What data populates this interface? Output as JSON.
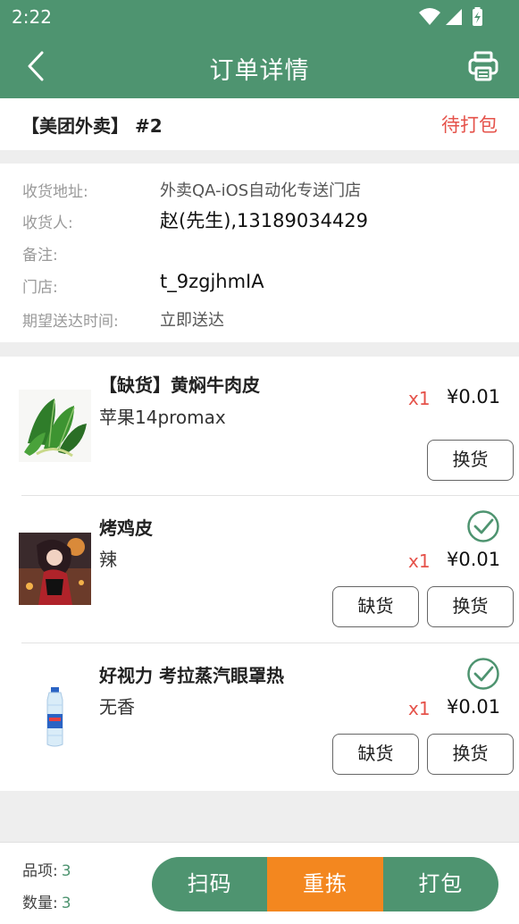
{
  "status_bar": {
    "time": "2:22"
  },
  "app_bar": {
    "title": "订单详情"
  },
  "order": {
    "source": "【美团外卖】 #2",
    "state": "待打包"
  },
  "info": {
    "address_label": "收货地址:",
    "address": "外卖QA-iOS自动化专送门店",
    "receiver_label": "收货人:",
    "receiver": "赵(先生),13189034429",
    "remark_label": "备注:",
    "remark": "",
    "store_label": "门店:",
    "store": "t_9zgjhmIA",
    "delivery_label": "期望送达时间:",
    "delivery": "立即送达"
  },
  "items": [
    {
      "name": "【缺货】黄焖牛肉皮",
      "spec": "苹果14promax",
      "qty": "x1",
      "price": "¥0.01",
      "swap_label": "换货"
    },
    {
      "name": "烤鸡皮",
      "spec": "辣",
      "qty": "x1",
      "price": "¥0.01",
      "out_label": "缺货",
      "swap_label": "换货"
    },
    {
      "name": "好视力 考拉蒸汽眼罩热",
      "spec": "无香",
      "qty": "x1",
      "price": "¥0.01",
      "out_label": "缺货",
      "swap_label": "换货"
    }
  ],
  "footer": {
    "items_label": "品项:",
    "items_count": "3",
    "qty_label": "数量:",
    "qty_count": "3",
    "scan_label": "扫码",
    "repick_label": "重拣",
    "pack_label": "打包"
  },
  "colors": {
    "brand_green": "#4e9470",
    "accent_orange": "#f3871f",
    "alert_red": "#e5524a"
  }
}
